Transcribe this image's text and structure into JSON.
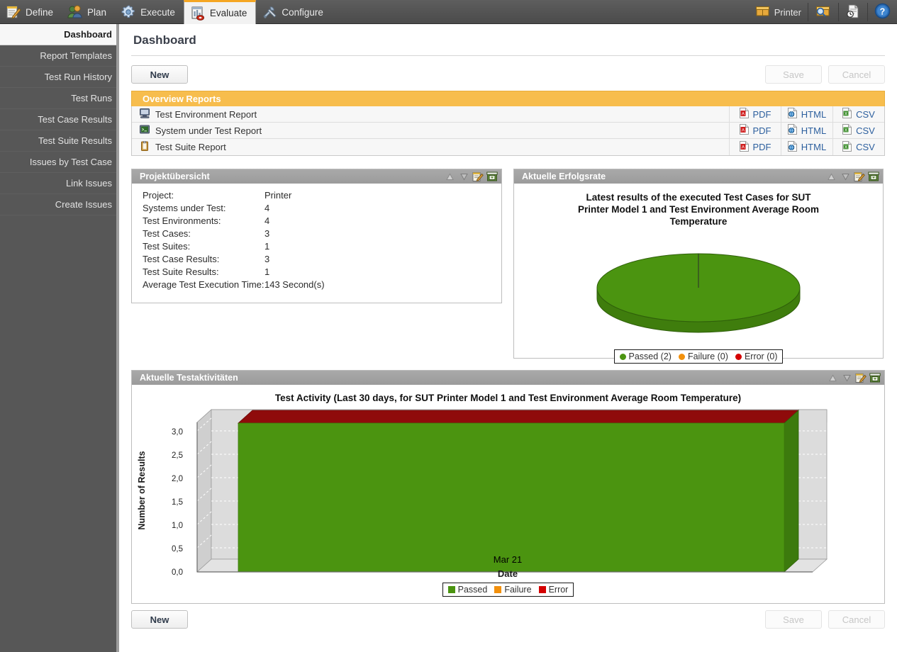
{
  "nav": {
    "tabs": [
      {
        "label": "Define",
        "icon": "notepad-pencil-icon",
        "active": false
      },
      {
        "label": "Plan",
        "icon": "people-icon",
        "active": false
      },
      {
        "label": "Execute",
        "icon": "gear-icon",
        "active": false
      },
      {
        "label": "Evaluate",
        "icon": "report-chart-icon",
        "active": true
      },
      {
        "label": "Configure",
        "icon": "tools-icon",
        "active": false
      }
    ],
    "right": {
      "project_label": "Printer",
      "project_icon": "box-icon",
      "search_icon": "box-magnifier-icon",
      "history_icon": "document-clock-icon",
      "help_icon": "help-question-icon"
    }
  },
  "sidebar": {
    "items": [
      {
        "label": "Dashboard",
        "active": true
      },
      {
        "label": "Report Templates",
        "active": false
      },
      {
        "label": "Test Run History",
        "active": false
      },
      {
        "label": "Test Runs",
        "active": false
      },
      {
        "label": "Test Case Results",
        "active": false
      },
      {
        "label": "Test Suite Results",
        "active": false
      },
      {
        "label": "Issues by Test Case",
        "active": false
      },
      {
        "label": "Link Issues",
        "active": false
      },
      {
        "label": "Create Issues",
        "active": false
      }
    ]
  },
  "page": {
    "title": "Dashboard",
    "buttons": {
      "new": "New",
      "save": "Save",
      "cancel": "Cancel"
    }
  },
  "overview_reports": {
    "header": "Overview Reports",
    "actions": [
      "PDF",
      "HTML",
      "CSV"
    ],
    "rows": [
      {
        "name": "Test Environment Report",
        "icon": "monitor-icon"
      },
      {
        "name": "System under Test Report",
        "icon": "terminal-icon"
      },
      {
        "name": "Test Suite Report",
        "icon": "clipboard-icon"
      }
    ]
  },
  "panels": {
    "project_overview": {
      "title": "Projektübersicht",
      "rows": [
        {
          "key": "Project:",
          "value": "Printer"
        },
        {
          "key": "Systems under Test:",
          "value": "4"
        },
        {
          "key": "Test Environments:",
          "value": "4"
        },
        {
          "key": "Test Cases:",
          "value": "3"
        },
        {
          "key": "Test Suites:",
          "value": "1"
        },
        {
          "key": "Test Case Results:",
          "value": "3"
        },
        {
          "key": "Test Suite Results:",
          "value": "1"
        },
        {
          "key": "Average Test Execution Time:",
          "value": "143 Second(s)"
        }
      ]
    },
    "success_rate": {
      "title": "Aktuelle Erfolgsrate"
    },
    "test_activity": {
      "title": "Aktuelle Testaktivitäten"
    },
    "icons": {
      "move_up": "triangle-up-icon",
      "move_down": "triangle-down-icon",
      "edit": "edit-notepad-icon",
      "delete": "delete-box-icon"
    }
  },
  "chart_data": [
    {
      "type": "pie",
      "title": "Latest results of the executed Test Cases for SUT Printer Model 1 and Test Environment Average Room Temperature",
      "title_lines": [
        "Latest results of the executed Test Cases for SUT",
        "Printer Model 1 and Test Environment Average Room",
        "Temperature"
      ],
      "categories": [
        "Passed",
        "Failure",
        "Error"
      ],
      "values": [
        2,
        0,
        0
      ],
      "legend_labels": [
        "Passed (2)",
        "Failure (0)",
        "Error (0)"
      ],
      "colors": [
        "#4b9410",
        "#f2900c",
        "#d40000"
      ],
      "legend_position": "bottom",
      "three_d": true
    },
    {
      "type": "bar",
      "title": "Test Activity (Last 30 days, for SUT Printer Model 1 and Test Environment Average Room Temperature)",
      "xlabel": "Date",
      "ylabel": "Number of Results",
      "categories": [
        "Mar 21"
      ],
      "xticklabels": [
        "Mar 21"
      ],
      "yticklabels": [
        "0,0",
        "0,5",
        "1,0",
        "1,5",
        "2,0",
        "2,5",
        "3,0"
      ],
      "ylim": [
        0,
        3
      ],
      "grid": true,
      "three_d": true,
      "series": [
        {
          "name": "Passed",
          "values": [
            3
          ],
          "color": "#4b9410"
        },
        {
          "name": "Failure",
          "values": [
            0
          ],
          "color": "#f2900c"
        },
        {
          "name": "Error",
          "values": [
            0
          ],
          "color": "#d40000"
        }
      ],
      "legend_labels": [
        "Passed",
        "Failure",
        "Error"
      ],
      "legend_position": "bottom"
    }
  ]
}
